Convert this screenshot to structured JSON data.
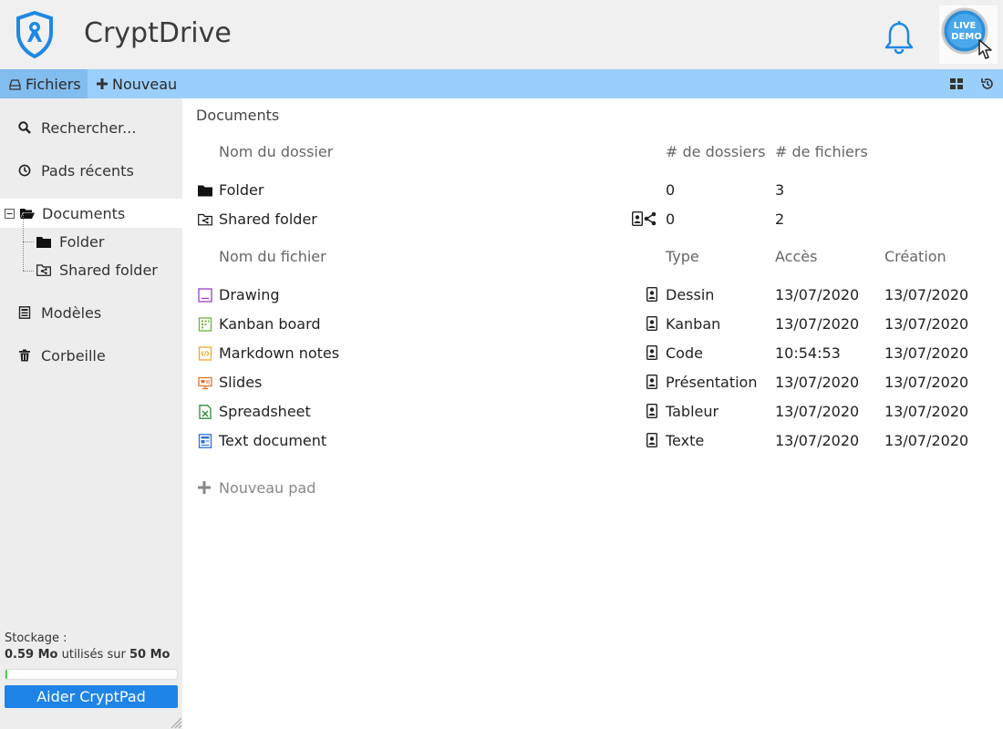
{
  "app": {
    "title": "CryptDrive"
  },
  "avatar": {
    "line1": "LIVE",
    "line2": "DEMO"
  },
  "toolbar": {
    "files_label": "Fichiers",
    "new_label": "Nouveau"
  },
  "sidebar": {
    "search": "Rechercher...",
    "recent": "Pads récents",
    "documents": "Documents",
    "folder": "Folder",
    "shared_folder": "Shared folder",
    "templates": "Modèles",
    "trash": "Corbeille"
  },
  "storage": {
    "label": "Stockage :",
    "used": "0.59 Mo",
    "middle": " utilisés sur ",
    "total": "50 Mo",
    "fraction": 0.012
  },
  "help_button": "Aider CryptPad",
  "main": {
    "breadcrumb": "Documents",
    "folder_headers": {
      "name": "Nom du dossier",
      "folders": "# de dossiers",
      "files": "# de fichiers"
    },
    "folders": [
      {
        "name": "Folder",
        "folders": "0",
        "files": "3"
      },
      {
        "name": "Shared folder",
        "folders": "0",
        "files": "2"
      }
    ],
    "file_headers": {
      "name": "Nom du fichier",
      "type": "Type",
      "access": "Accès",
      "created": "Création"
    },
    "files": [
      {
        "name": "Drawing",
        "type": "Dessin",
        "access": "13/07/2020",
        "created": "13/07/2020",
        "icon": "drawing-icon",
        "color": "#9b3fbf"
      },
      {
        "name": "Kanban board",
        "type": "Kanban",
        "access": "13/07/2020",
        "created": "13/07/2020",
        "icon": "kanban-icon",
        "color": "#6cb33f"
      },
      {
        "name": "Markdown notes",
        "type": "Code",
        "access": "10:54:53",
        "created": "13/07/2020",
        "icon": "code-icon",
        "color": "#f0a830"
      },
      {
        "name": "Slides",
        "type": "Présentation",
        "access": "13/07/2020",
        "created": "13/07/2020",
        "icon": "slides-icon",
        "color": "#e8702a"
      },
      {
        "name": "Spreadsheet",
        "type": "Tableur",
        "access": "13/07/2020",
        "created": "13/07/2020",
        "icon": "spreadsheet-icon",
        "color": "#2f8a3e"
      },
      {
        "name": "Text document",
        "type": "Texte",
        "access": "13/07/2020",
        "created": "13/07/2020",
        "icon": "text-doc-icon",
        "color": "#2b6fd6"
      }
    ],
    "new_pad": "Nouveau pad"
  },
  "colors": {
    "toolbar": "#9bcffb",
    "toolbar_active": "#82bdf0",
    "accent": "#1e84e8",
    "brand": "#1e88e5"
  }
}
